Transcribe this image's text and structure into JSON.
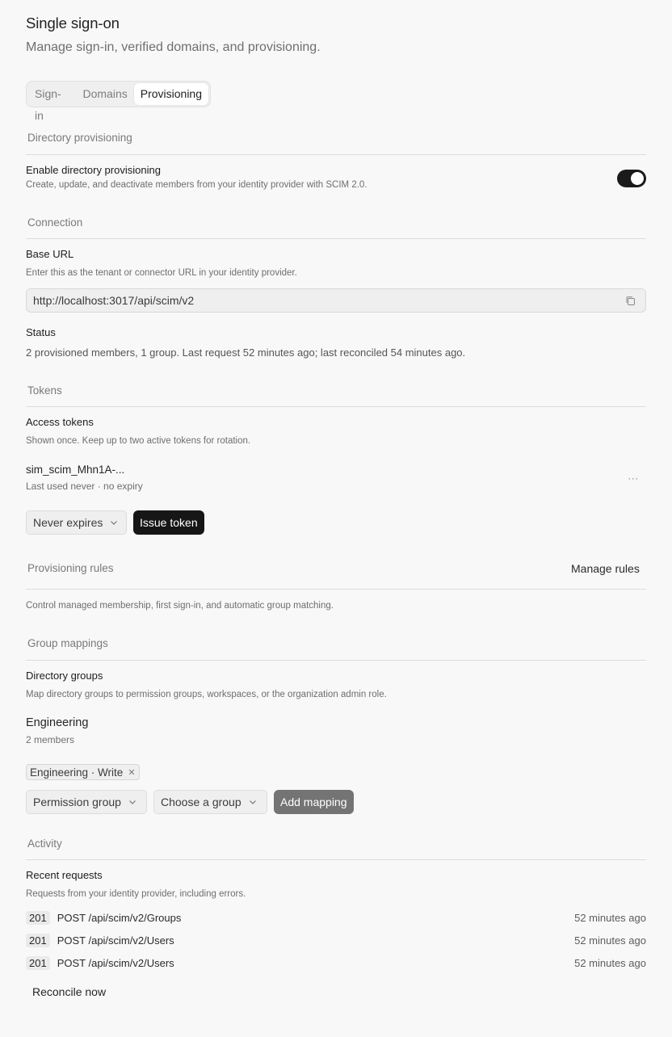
{
  "header": {
    "title": "Single sign-on",
    "subtitle": "Manage sign-in, verified domains, and provisioning."
  },
  "tabs": [
    {
      "label": "Sign-in",
      "active": false
    },
    {
      "label": "Domains",
      "active": false
    },
    {
      "label": "Provisioning",
      "active": true
    }
  ],
  "directory_provisioning": {
    "section_title": "Directory provisioning",
    "toggle_label": "Enable directory provisioning",
    "toggle_desc": "Create, update, and deactivate members from your identity provider with SCIM 2.0.",
    "enabled": true
  },
  "connection": {
    "section_title": "Connection",
    "base_url_label": "Base URL",
    "base_url_desc": "Enter this as the tenant or connector URL in your identity provider.",
    "base_url_value": "http://localhost:3017/api/scim/v2",
    "status_label": "Status",
    "status_text": "2 provisioned members, 1 group. Last request 52 minutes ago; last reconciled 54 minutes ago."
  },
  "tokens": {
    "section_title": "Tokens",
    "access_label": "Access tokens",
    "access_desc": "Shown once. Keep up to two active tokens for rotation.",
    "token_name": "sim_scim_Mhn1A-...",
    "token_meta": "Last used never · no expiry",
    "more_label": "···",
    "expiry_select": "Never expires",
    "issue_button": "Issue token"
  },
  "provisioning_rules": {
    "section_title": "Provisioning rules",
    "manage_button": "Manage rules",
    "desc": "Control managed membership, first sign-in, and automatic group matching."
  },
  "group_mappings": {
    "section_title": "Group mappings",
    "directory_label": "Directory groups",
    "directory_desc": "Map directory groups to permission groups, workspaces, or the organization admin role.",
    "group_name": "Engineering",
    "group_meta": "2 members",
    "chip_label": "Engineering · Write",
    "type_select": "Permission group",
    "target_select": "Choose a group",
    "add_button": "Add mapping"
  },
  "activity": {
    "section_title": "Activity",
    "recent_label": "Recent requests",
    "recent_desc": "Requests from your identity provider, including errors.",
    "requests": [
      {
        "code": "201",
        "path": "POST /api/scim/v2/Groups",
        "time": "52 minutes ago"
      },
      {
        "code": "201",
        "path": "POST /api/scim/v2/Users",
        "time": "52 minutes ago"
      },
      {
        "code": "201",
        "path": "POST /api/scim/v2/Users",
        "time": "52 minutes ago"
      }
    ],
    "reconcile_button": "Reconcile now"
  },
  "icons": {
    "copy": "copy-icon",
    "chevron": "chevron-down-icon",
    "close": "close-icon"
  },
  "colors": {
    "background": "#f8f8f8",
    "toggle_on": "#1a1a1a",
    "primary_button": "#161616",
    "disabled_button": "#747474"
  }
}
